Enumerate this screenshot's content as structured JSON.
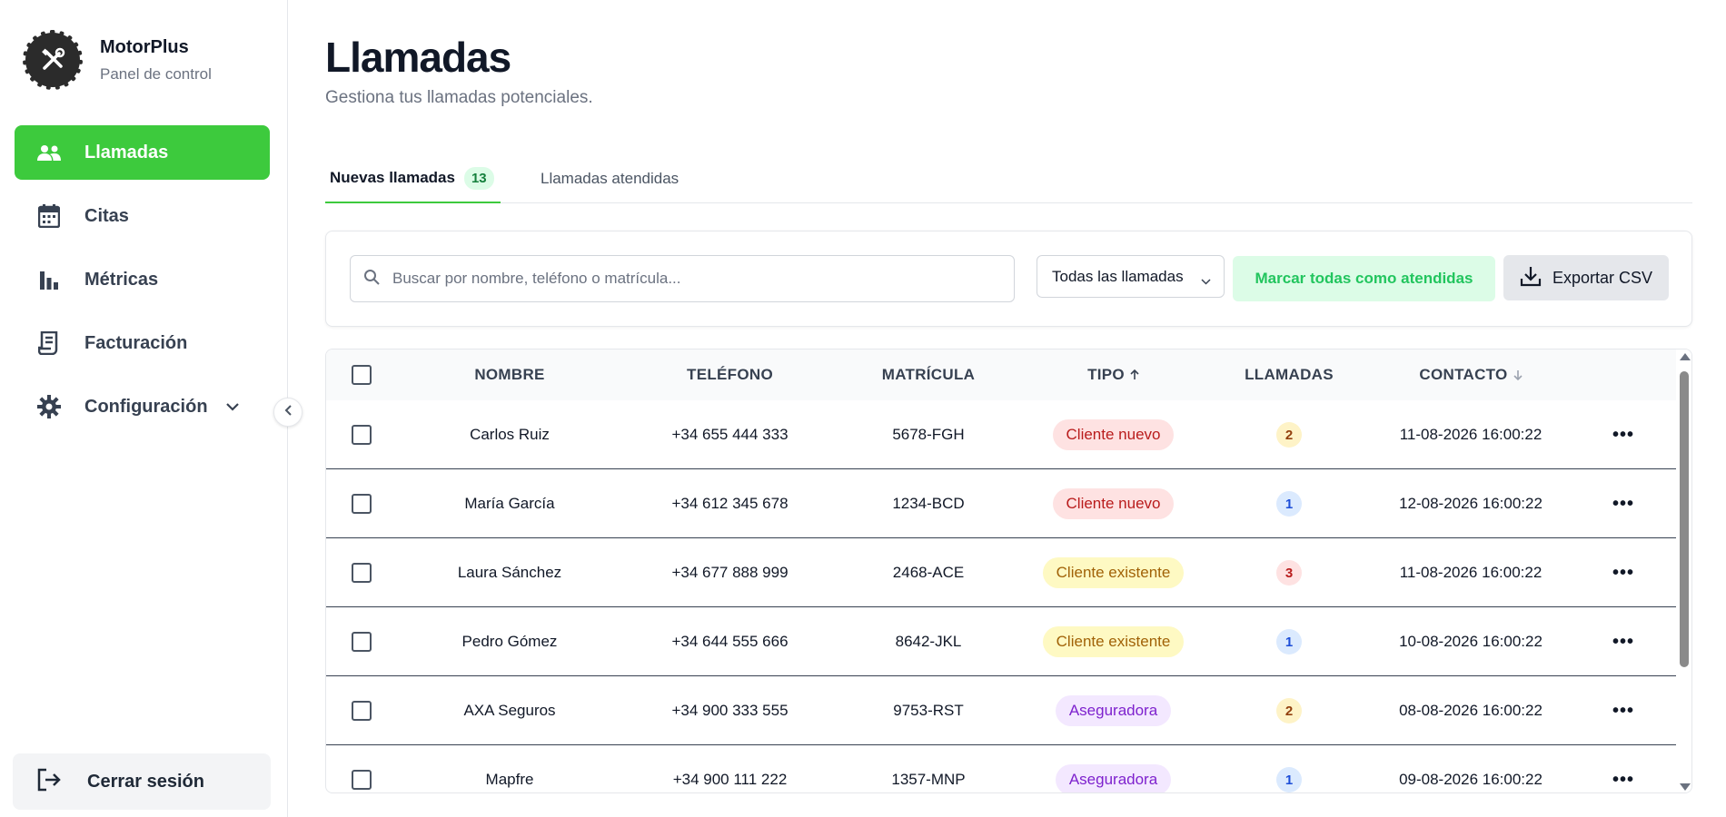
{
  "brand": {
    "name": "MotorPlus",
    "subtitle": "Panel de control"
  },
  "sidebar": {
    "items": [
      {
        "label": "Llamadas",
        "icon": "users-icon",
        "active": true
      },
      {
        "label": "Citas",
        "icon": "calendar-icon"
      },
      {
        "label": "Métricas",
        "icon": "bar-chart-icon"
      },
      {
        "label": "Facturación",
        "icon": "receipt-icon"
      },
      {
        "label": "Configuración",
        "icon": "gear-icon",
        "expandable": true
      }
    ],
    "logout": {
      "label": "Cerrar sesión",
      "icon": "logout-icon"
    }
  },
  "page": {
    "title": "Llamadas",
    "subtitle": "Gestiona tus llamadas potenciales."
  },
  "tabs": [
    {
      "label": "Nuevas llamadas",
      "badge": "13",
      "active": true
    },
    {
      "label": "Llamadas atendidas"
    }
  ],
  "toolbar": {
    "search_placeholder": "Buscar por nombre, teléfono o matrícula...",
    "filter_selected": "Todas las llamadas",
    "mark_all_label": "Marcar todas como atendidas",
    "export_label": "Exportar CSV"
  },
  "table": {
    "headers": [
      "NOMBRE",
      "TELÉFONO",
      "MATRÍCULA",
      "TIPO",
      "LLAMADAS",
      "CONTACTO"
    ],
    "rows": [
      {
        "nombre": "Carlos Ruiz",
        "telefono": "+34 655 444 333",
        "matricula": "5678-FGH",
        "tipo": "Cliente nuevo",
        "llamadas": "2",
        "contacto": "11-08-2026 16:00:22"
      },
      {
        "nombre": "María García",
        "telefono": "+34 612 345 678",
        "matricula": "1234-BCD",
        "tipo": "Cliente nuevo",
        "llamadas": "1",
        "contacto": "12-08-2026 16:00:22"
      },
      {
        "nombre": "Laura Sánchez",
        "telefono": "+34 677 888 999",
        "matricula": "2468-ACE",
        "tipo": "Cliente existente",
        "llamadas": "3",
        "contacto": "11-08-2026 16:00:22"
      },
      {
        "nombre": "Pedro Gómez",
        "telefono": "+34 644 555 666",
        "matricula": "8642-JKL",
        "tipo": "Cliente existente",
        "llamadas": "1",
        "contacto": "10-08-2026 16:00:22"
      },
      {
        "nombre": "AXA Seguros",
        "telefono": "+34 900 333 555",
        "matricula": "9753-RST",
        "tipo": "Aseguradora",
        "llamadas": "2",
        "contacto": "08-08-2026 16:00:22"
      },
      {
        "nombre": "Mapfre",
        "telefono": "+34 900 111 222",
        "matricula": "1357-MNP",
        "tipo": "Aseguradora",
        "llamadas": "1",
        "contacto": "09-08-2026 16:00:22"
      }
    ],
    "row_menu_glyph": "•••"
  },
  "colors": {
    "accent": "#3dca3d",
    "text": "#111827",
    "muted": "#6b7280"
  }
}
